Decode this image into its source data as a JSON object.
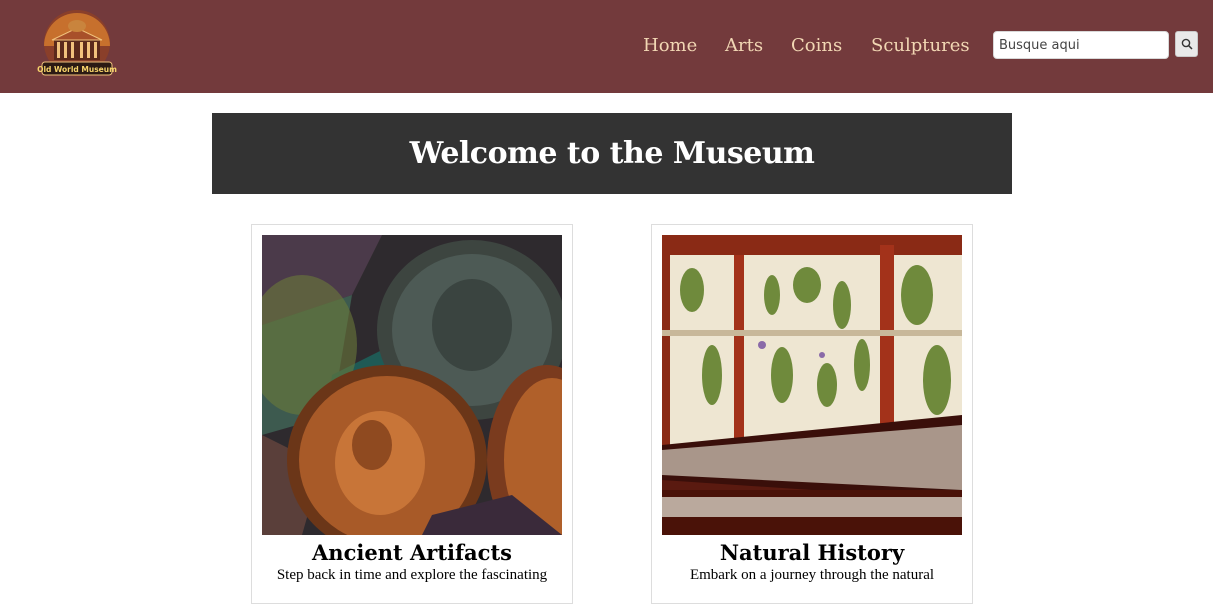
{
  "header": {
    "logo_text": "Old World Museum",
    "nav": [
      {
        "label": "Home"
      },
      {
        "label": "Arts"
      },
      {
        "label": "Coins"
      },
      {
        "label": "Sculptures"
      }
    ],
    "search": {
      "placeholder": "Busque aqui",
      "value": ""
    }
  },
  "hero": {
    "title": "Welcome to the Museum"
  },
  "cards": [
    {
      "title": "Ancient Artifacts",
      "text": "Step back in time and explore the fascinating"
    },
    {
      "title": "Natural History",
      "text": "Embark on a journey through the natural"
    }
  ],
  "colors": {
    "header_bg": "#733a3c",
    "nav_text": "#f2d7b4",
    "hero_bg": "#333333"
  }
}
